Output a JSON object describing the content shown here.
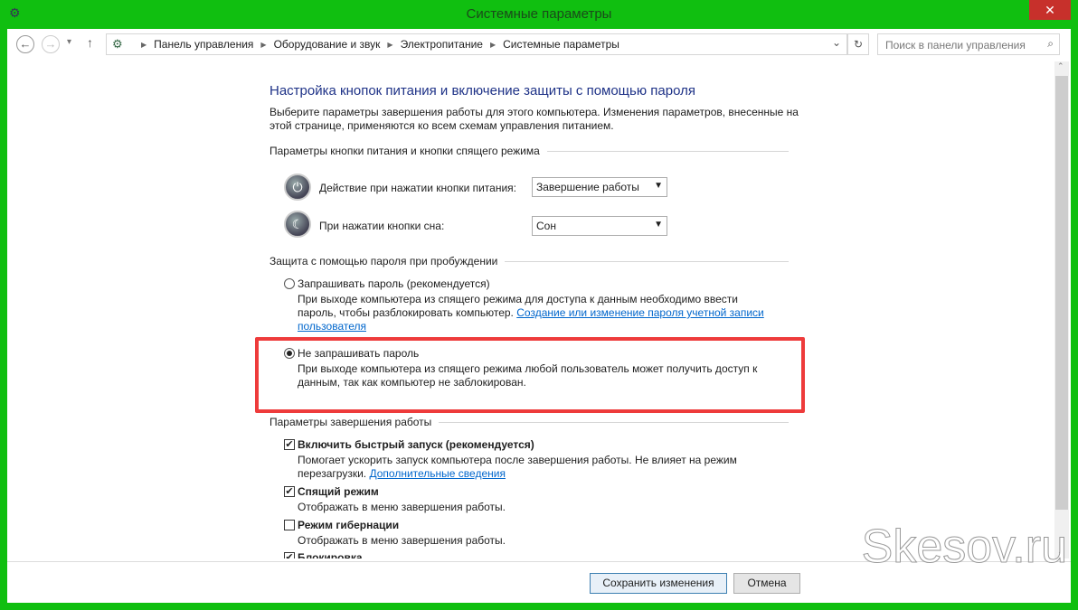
{
  "window": {
    "title": "Системные параметры",
    "close": "✕",
    "app_icon": "control-panel-icon"
  },
  "nav": {
    "back": "←",
    "forward": "→",
    "recent": "▾",
    "up": "↑",
    "breadcrumb": [
      "Панель управления",
      "Оборудование и звук",
      "Электропитание",
      "Системные параметры"
    ],
    "dropdown": "⌄",
    "refresh": "↻",
    "search_placeholder": "Поиск в панели управления",
    "search_icon": "⌕"
  },
  "main": {
    "heading": "Настройка кнопок питания и включение защиты с помощью пароля",
    "intro1": "Выберите параметры завершения работы для этого компьютера. Изменения параметров, внесенные на",
    "intro2": "этой странице, применяются ко всем схемам управления питанием.",
    "power_group": "Параметры кнопки питания и кнопки спящего режима",
    "power_button_label": "Действие при нажатии кнопки питания:",
    "power_button_value": "Завершение работы",
    "sleep_button_label": "При нажатии кнопки сна:",
    "sleep_button_value": "Сон",
    "password_group": "Защита с помощью пароля при пробуждении",
    "require_label": "Запрашивать пароль (рекомендуется)",
    "require_desc1": "При выходе компьютера из спящего режима для доступа к данным необходимо ввести",
    "require_desc2": "пароль, чтобы разблокировать компьютер.",
    "require_link1": "Создание или изменение пароля учетной записи",
    "require_link2": "пользователя",
    "norequire_label": "Не запрашивать пароль",
    "norequire_desc1": "При выходе компьютера из спящего режима любой пользователь может получить доступ к",
    "norequire_desc2": "данным, так как компьютер не заблокирован.",
    "shutdown_group": "Параметры завершения работы",
    "fast_label": "Включить быстрый запуск (рекомендуется)",
    "fast_desc1": "Помогает ускорить запуск компьютера после завершения работы. Не влияет на режим",
    "fast_desc2": "перезагрузки.",
    "fast_link": "Дополнительные сведения",
    "sleep_label": "Спящий режим",
    "sleep_desc": "Отображать в меню завершения работы.",
    "hibernate_label": "Режим гибернации",
    "hibernate_desc": "Отображать в меню завершения работы.",
    "lock_label": "Блокировка",
    "checkmark": "✔"
  },
  "footer": {
    "save": "Сохранить изменения",
    "cancel": "Отмена"
  },
  "watermark": "Skesov.ru",
  "colors": {
    "titlebar": "#10bf10",
    "highlight": "#ee3b3b",
    "link": "#0066cc"
  }
}
